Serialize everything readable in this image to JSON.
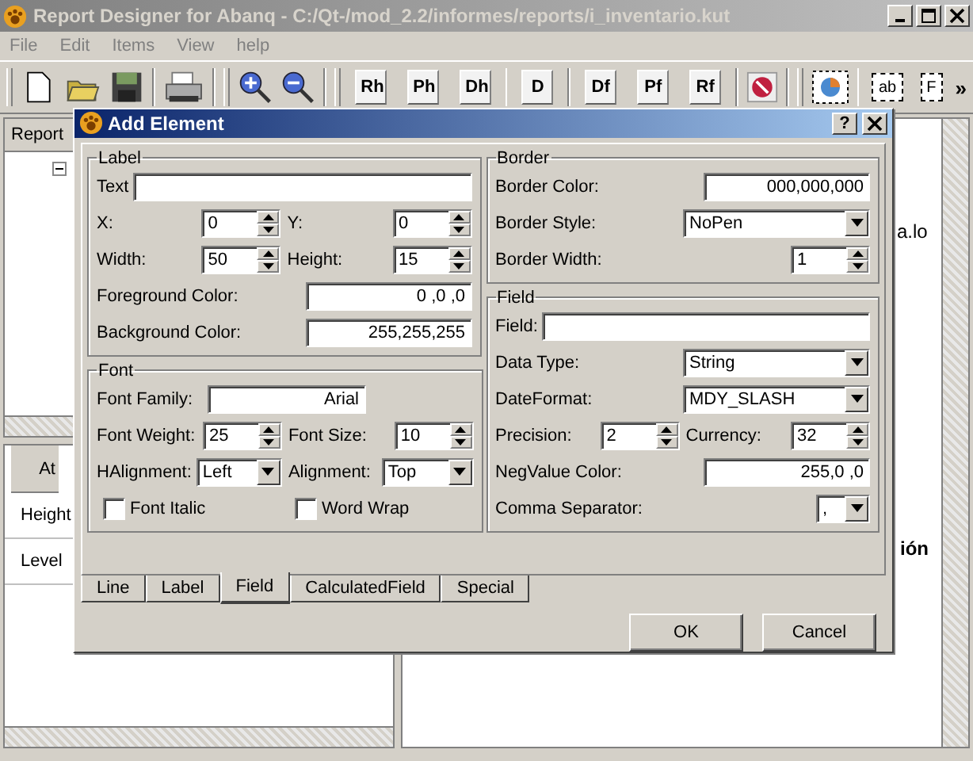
{
  "window": {
    "title": "Report Designer for Abanq - C:/Qt-/mod_2.2/informes/reports/i_inventario.kut"
  },
  "menu": [
    "File",
    "Edit",
    "Items",
    "View",
    "help"
  ],
  "section_buttons": [
    "Rh",
    "Ph",
    "Dh",
    "D",
    "Df",
    "Pf",
    "Rf"
  ],
  "field_tools": [
    "ab",
    "F"
  ],
  "toolbar_overflow": "»",
  "tree_header": "Report",
  "properties": {
    "header": "At",
    "rows": [
      "Height",
      "Level"
    ]
  },
  "canvas_texts": [
    "a.lo",
    "ión"
  ],
  "dialog": {
    "title": "Add Element",
    "help_button": "?",
    "left_groups": [
      {
        "title": "Label",
        "rows": [
          [
            {
              "label": "Text",
              "kind": "text"
            }
          ],
          [
            {
              "label": "X:",
              "kind": "spin",
              "value": "0"
            },
            {
              "label": "Y:",
              "kind": "spin",
              "value": "0"
            }
          ],
          [
            {
              "label": "Width:",
              "kind": "spin",
              "value": "50"
            },
            {
              "label": "Height:",
              "kind": "spin",
              "value": "15"
            }
          ],
          [
            {
              "label": "Foreground Color:",
              "kind": "color",
              "value": "0 ,0 ,0"
            }
          ],
          [
            {
              "label": "Background Color:",
              "kind": "color",
              "value": "255,255,255"
            }
          ]
        ]
      },
      {
        "title": "Font",
        "rows": [
          [
            {
              "label": "Font Family:",
              "kind": "family",
              "value": "Arial"
            }
          ],
          [
            {
              "label": "Font Weight:",
              "kind": "spin",
              "value": "25"
            },
            {
              "label": "Font Size:",
              "kind": "spin",
              "value": "10"
            }
          ],
          [
            {
              "label": "HAlignment:",
              "kind": "combo",
              "value": "Left"
            },
            {
              "label": "Alignment:",
              "kind": "combo",
              "value": "Top"
            }
          ],
          [
            {
              "label": "Font Italic",
              "kind": "check",
              "checked": false
            },
            {
              "label": "Word Wrap",
              "kind": "check",
              "checked": false
            }
          ]
        ]
      }
    ],
    "right_groups": [
      {
        "title": "Border",
        "rows": [
          [
            {
              "label": "Border Color:",
              "kind": "color",
              "value": "000,000,000"
            }
          ],
          [
            {
              "label": "Border Style:",
              "kind": "combo",
              "value": "NoPen"
            }
          ],
          [
            {
              "label": "Border Width:",
              "kind": "spin",
              "value": "1"
            }
          ]
        ]
      },
      {
        "title": "Field",
        "rows": [
          [
            {
              "label": "Field:",
              "kind": "text"
            }
          ],
          [
            {
              "label": "Data Type:",
              "kind": "combo",
              "value": "String"
            }
          ],
          [
            {
              "label": "DateFormat:",
              "kind": "combo",
              "value": "MDY_SLASH"
            }
          ],
          [
            {
              "label": "Precision:",
              "kind": "spin",
              "value": "2"
            },
            {
              "label": "Currency:",
              "kind": "spin",
              "value": "32"
            }
          ],
          [
            {
              "label": "NegValue Color:",
              "kind": "color",
              "value": "255,0 ,0"
            }
          ],
          [
            {
              "label": "Comma Separator:",
              "kind": "small-combo",
              "value": ","
            }
          ]
        ]
      }
    ],
    "tabs": [
      {
        "label": "Line",
        "selected": false
      },
      {
        "label": "Label",
        "selected": false
      },
      {
        "label": "Field",
        "selected": true
      },
      {
        "label": "CalculatedField",
        "selected": false
      },
      {
        "label": "Special",
        "selected": false
      }
    ],
    "buttons": [
      "OK",
      "Cancel"
    ]
  }
}
